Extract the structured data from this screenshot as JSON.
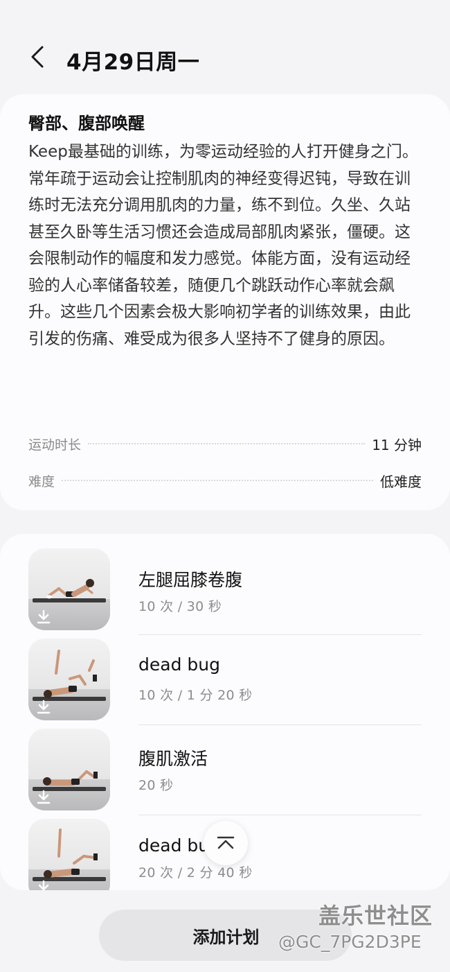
{
  "header": {
    "title": "4月29日周一"
  },
  "workout": {
    "title": "臀部、腹部唤醒",
    "description": "Keep最基础的训练，为零运动经验的人打开健身之门。常年疏于运动会让控制肌肉的神经变得迟钝，导致在训练时无法充分调用肌肉的力量，练不到位。久坐、久站甚至久卧等生活习惯还会造成局部肌肉紧张，僵硬。这会限制动作的幅度和发力感觉。体能方面，没有运动经验的人心率储备较差，随便几个跳跃动作心率就会飙升。这些几个因素会极大影响初学者的训练效果，由此引发的伤痛、难受成为很多人坚持不了健身的原因。",
    "duration_label": "运动时长",
    "duration_value": "11 分钟",
    "difficulty_label": "难度",
    "difficulty_value": "低难度"
  },
  "exercises": [
    {
      "name": "左腿屈膝卷腹",
      "detail": "10 次 / 30 秒"
    },
    {
      "name": "dead bug",
      "detail": "10 次 / 1 分 20 秒"
    },
    {
      "name": "腹肌激活",
      "detail": "20 秒"
    },
    {
      "name": "dead bug",
      "detail": "20 次 / 2 分 40 秒"
    }
  ],
  "actions": {
    "add_plan": "添加计划"
  },
  "watermark": {
    "brand": "盖乐世社区",
    "user": "@GC_7PG2D3PE"
  },
  "icons": {
    "back": "back-chevron-icon",
    "download": "download-icon",
    "scroll_top": "scroll-to-top-icon"
  }
}
